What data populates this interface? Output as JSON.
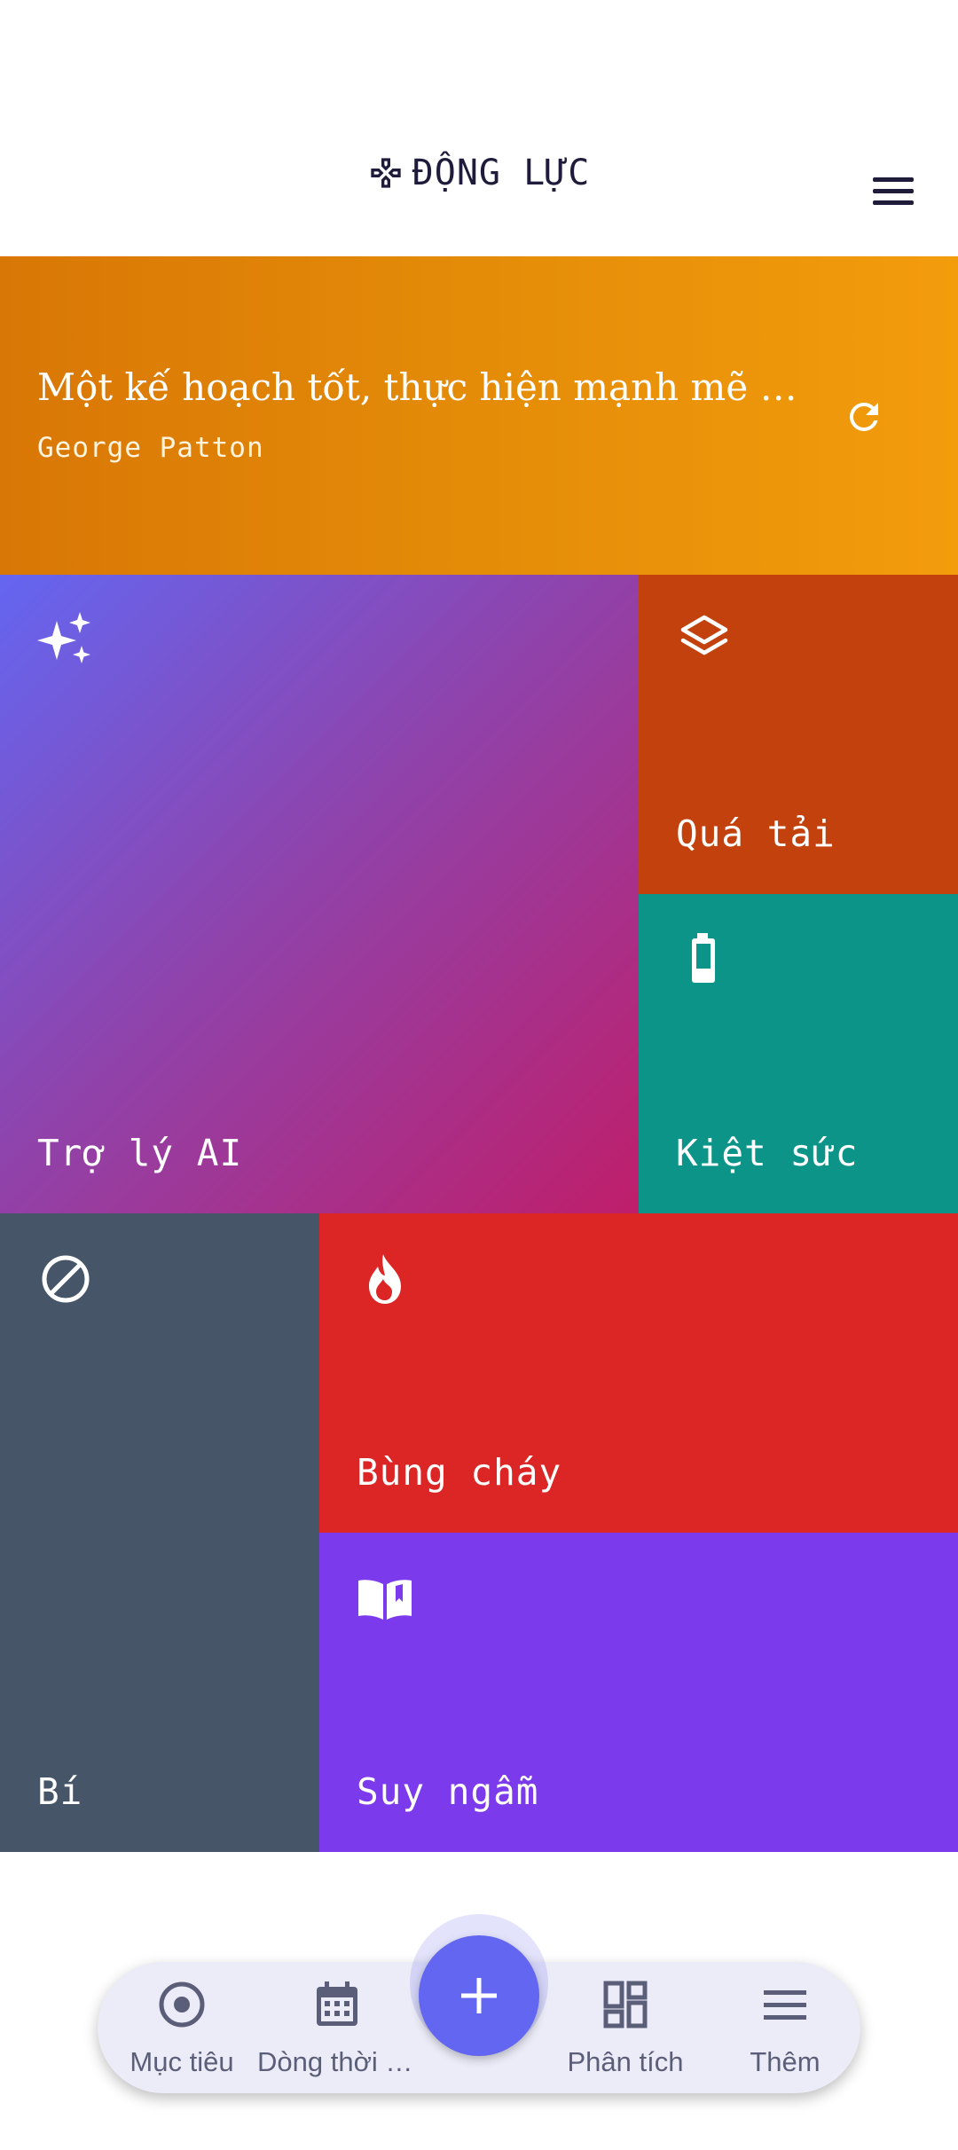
{
  "header": {
    "title": "ĐỘNG LỰC",
    "logo_icon": "gamepad-icon",
    "menu_icon": "hamburger-menu-icon"
  },
  "quote": {
    "text": "Một kế hoạch tốt, thực hiện mạnh mẽ ngay bây giờ",
    "author": "George Patton",
    "refresh_icon": "refresh-icon",
    "gradient_start": "#d97706",
    "gradient_end": "#f39c0c"
  },
  "tiles": {
    "ai_assistant": {
      "label": "Trợ lý AI",
      "icon": "sparkles-icon",
      "colors": [
        "#6466f1",
        "#bf1e6a"
      ]
    },
    "overload": {
      "label": "Quá tải",
      "icon": "layers-icon",
      "color": "#c2410c"
    },
    "burnout": {
      "label": "Kiệt sức",
      "icon": "battery-low-icon",
      "color": "#0d9488"
    },
    "stuck": {
      "label": "Bí",
      "icon": "block-icon",
      "color": "#475569"
    },
    "on_fire": {
      "label": "Bùng cháy",
      "icon": "flame-icon",
      "color": "#dc2626"
    },
    "reflect": {
      "label": "Suy ngẫm",
      "icon": "open-book-icon",
      "color": "#7c3aed"
    }
  },
  "bottom_nav": {
    "items": [
      {
        "label": "Mục tiêu",
        "icon": "target-icon"
      },
      {
        "label": "Dòng thời gian",
        "icon": "calendar-icon"
      },
      {
        "label": "Phân tích",
        "icon": "dashboard-icon"
      },
      {
        "label": "Thêm",
        "icon": "more-menu-icon"
      }
    ],
    "fab_icon": "plus-icon",
    "accent": "#6366f1",
    "background": "#ececf8"
  }
}
